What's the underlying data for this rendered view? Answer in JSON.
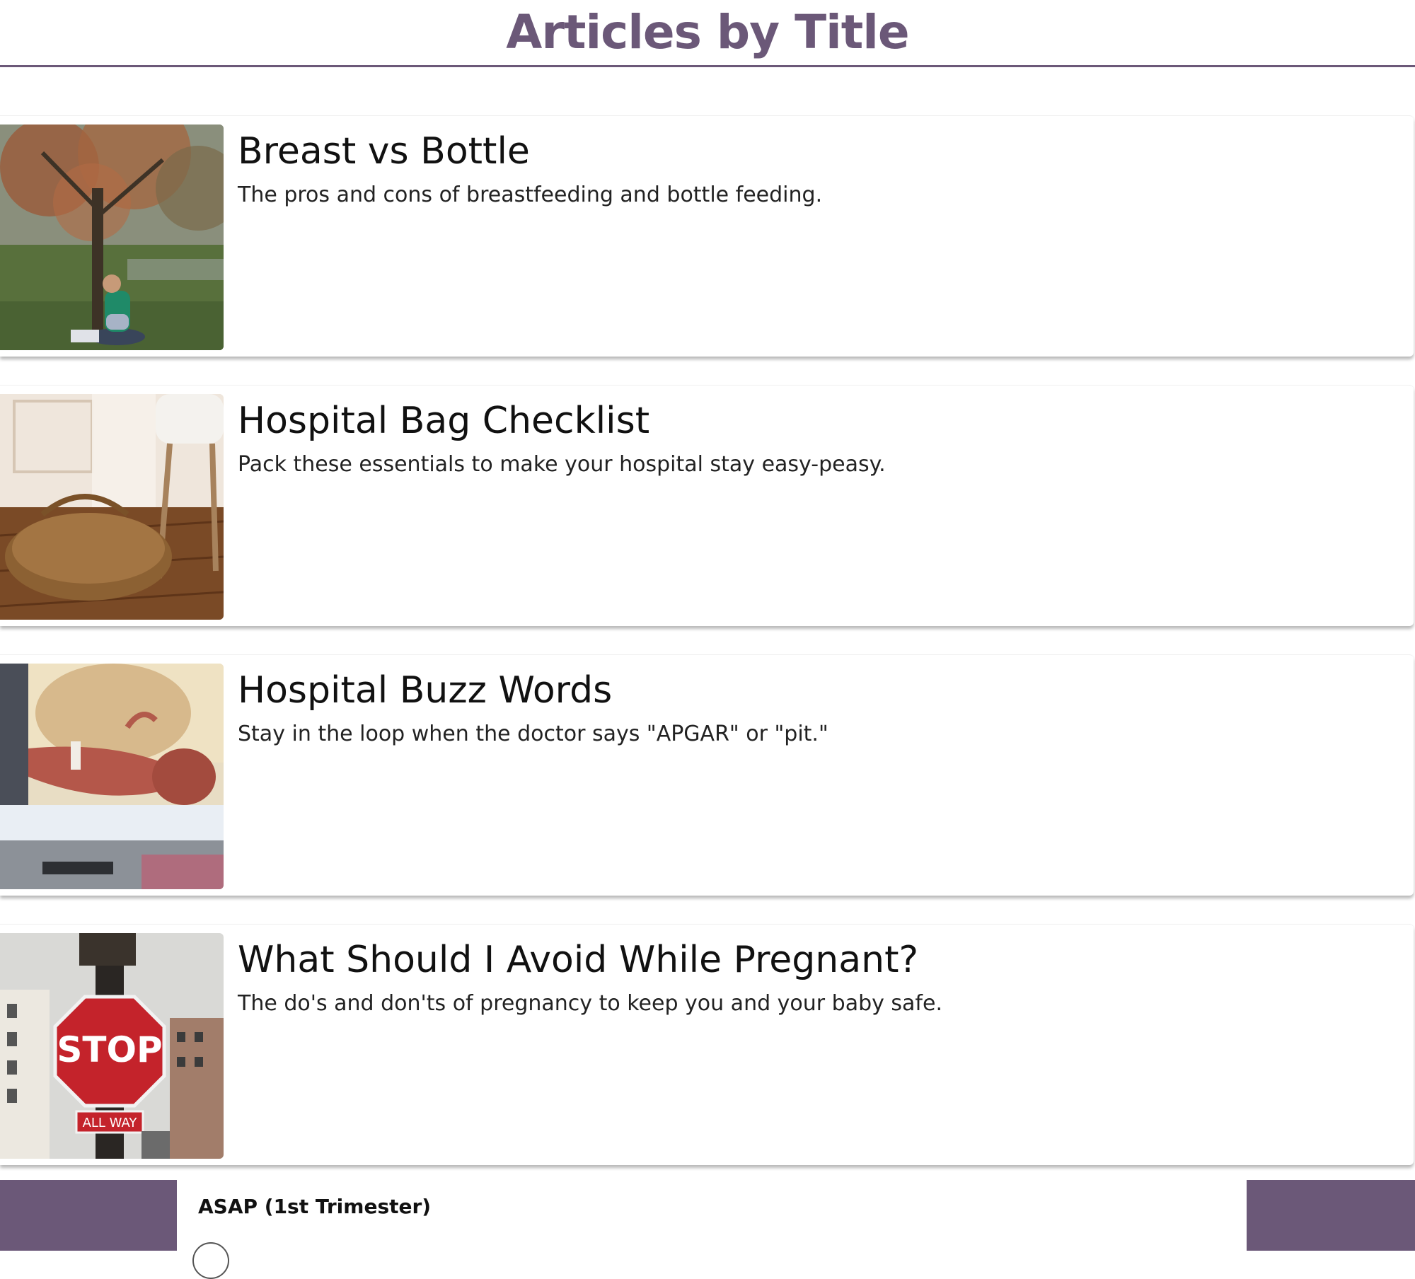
{
  "header": {
    "title": "Articles by Title"
  },
  "articles": [
    {
      "title": "Breast vs Bottle",
      "description": "The pros and cons of breastfeeding and bottle feeding.",
      "image": "mother-nursing-under-tree-photo"
    },
    {
      "title": "Hospital Bag Checklist",
      "description": "Pack these essentials to make your hospital stay easy-peasy.",
      "image": "duffel-bag-on-floor-photo"
    },
    {
      "title": "Hospital Buzz Words",
      "description": "Stay in the loop when the doctor says \"APGAR\" or \"pit.\"",
      "image": "newborn-in-hands-photo"
    },
    {
      "title": "What Should I Avoid While Pregnant?",
      "description": "The do's and don'ts of pregnancy to keep you and your baby safe.",
      "image": "stop-sign-photo"
    }
  ],
  "footer": {
    "section_label": "ASAP (1st Trimester)"
  },
  "colors": {
    "accent": "#6b5878",
    "text": "#111111"
  }
}
